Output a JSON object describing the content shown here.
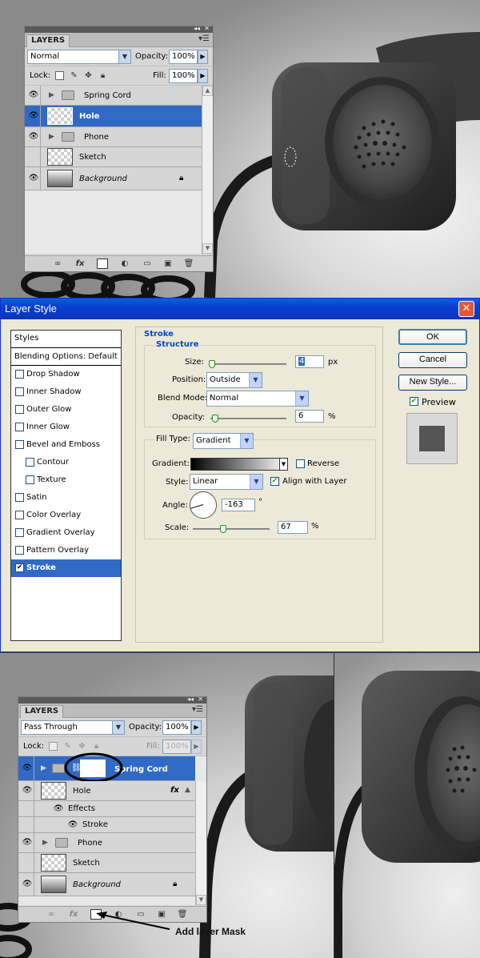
{
  "top_panel": {
    "tab": "LAYERS",
    "blend_mode": "Normal",
    "opacity_label": "Opacity:",
    "opacity": "100%",
    "lock_label": "Lock:",
    "fill_label": "Fill:",
    "fill": "100%",
    "layers": [
      {
        "name": "Spring Cord",
        "visible": true,
        "type": "group"
      },
      {
        "name": "Hole",
        "visible": true,
        "type": "layer",
        "selected": true
      },
      {
        "name": "Phone",
        "visible": true,
        "type": "group"
      },
      {
        "name": "Sketch",
        "visible": false,
        "type": "layer"
      },
      {
        "name": "Background",
        "visible": true,
        "type": "background",
        "locked": true
      }
    ],
    "bottom_icons": [
      "link-icon",
      "fx-icon",
      "mask-icon",
      "adjustment-icon",
      "folder-icon",
      "new-layer-icon",
      "trash-icon"
    ]
  },
  "dialog": {
    "title": "Layer Style",
    "styles_header": "Styles",
    "blending_options": "Blending Options: Default",
    "effects": [
      {
        "label": "Drop Shadow",
        "checked": false,
        "sub": false
      },
      {
        "label": "Inner Shadow",
        "checked": false,
        "sub": false
      },
      {
        "label": "Outer Glow",
        "checked": false,
        "sub": false
      },
      {
        "label": "Inner Glow",
        "checked": false,
        "sub": false
      },
      {
        "label": "Bevel and Emboss",
        "checked": false,
        "sub": false
      },
      {
        "label": "Contour",
        "checked": false,
        "sub": true
      },
      {
        "label": "Texture",
        "checked": false,
        "sub": true
      },
      {
        "label": "Satin",
        "checked": false,
        "sub": false
      },
      {
        "label": "Color Overlay",
        "checked": false,
        "sub": false
      },
      {
        "label": "Gradient Overlay",
        "checked": false,
        "sub": false
      },
      {
        "label": "Pattern Overlay",
        "checked": false,
        "sub": false
      },
      {
        "label": "Stroke",
        "checked": true,
        "sub": false,
        "selected": true
      }
    ],
    "stroke_title": "Stroke",
    "structure_title": "Structure",
    "size_label": "Size:",
    "size": "4",
    "size_unit": "px",
    "size_fraction": 0.02,
    "position_label": "Position:",
    "position": "Outside",
    "blend_label": "Blend Mode:",
    "blend": "Normal",
    "opacity_label": "Opacity:",
    "opacity": "6",
    "opacity_unit": "%",
    "opacity_fraction": 0.06,
    "filltype_label": "Fill Type:",
    "filltype": "Gradient",
    "gradient_label": "Gradient:",
    "reverse_label": "Reverse",
    "reverse_checked": false,
    "style_label": "Style:",
    "style": "Linear",
    "align_label": "Align with Layer",
    "align_checked": true,
    "angle_label": "Angle:",
    "angle": "-163",
    "angle_unit": "°",
    "scale_label": "Scale:",
    "scale": "67",
    "scale_unit": "%",
    "scale_fraction": 0.4,
    "ok": "OK",
    "cancel": "Cancel",
    "new_style": "New Style...",
    "preview_label": "Preview",
    "preview_checked": true
  },
  "bottom_panel": {
    "tab": "LAYERS",
    "blend_mode": "Pass Through",
    "opacity_label": "Opacity:",
    "opacity": "100%",
    "lock_label": "Lock:",
    "fill_label": "Fill:",
    "fill": "100%",
    "layers": [
      {
        "name": "Spring Cord",
        "visible": true,
        "type": "group",
        "selected": true,
        "mask": true
      },
      {
        "name": "Hole",
        "visible": true,
        "type": "layer",
        "fx": true
      },
      {
        "name": "Effects",
        "type": "effects-header"
      },
      {
        "name": "Stroke",
        "type": "effect"
      },
      {
        "name": "Phone",
        "visible": true,
        "type": "group"
      },
      {
        "name": "Sketch",
        "visible": false,
        "type": "layer"
      },
      {
        "name": "Background",
        "visible": true,
        "type": "background",
        "locked": true
      }
    ],
    "fx_label": "fx"
  },
  "annotation": "Add layer Mask"
}
